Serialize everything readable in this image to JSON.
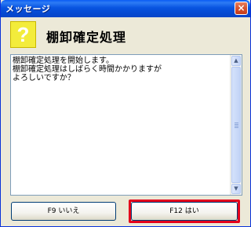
{
  "window": {
    "title": "メッセージ",
    "close_glyph": "×"
  },
  "header": {
    "icon_glyph": "?",
    "icon_color": "#f3ec3b",
    "heading": "棚卸確定処理"
  },
  "message": {
    "text": "棚卸確定処理を開始します。\n棚卸確定処理はしばらく時間かかりますが\nよろしいですか？"
  },
  "scrollbar": {
    "up_glyph": "▲",
    "down_glyph": "▼"
  },
  "buttons": {
    "no_label": "F9 いいえ",
    "yes_label": "F12 はい"
  },
  "colors": {
    "titlebar": "#0854e0",
    "highlight": "#e3001b"
  }
}
